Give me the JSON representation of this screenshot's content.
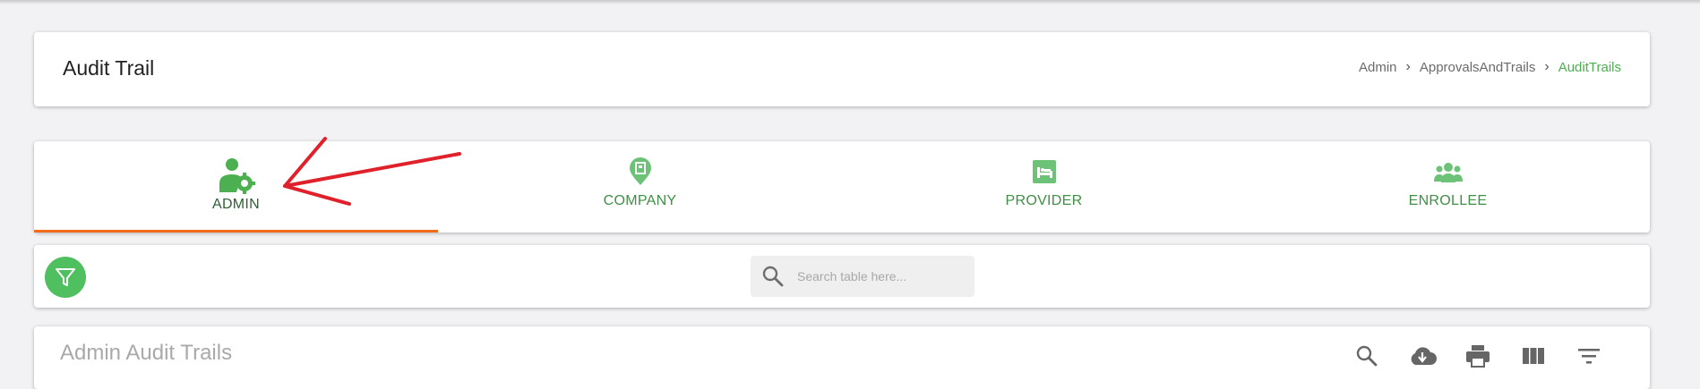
{
  "header": {
    "title": "Audit Trail",
    "breadcrumb": [
      "Admin",
      "ApprovalsAndTrails",
      "AuditTrails"
    ]
  },
  "tabs": [
    {
      "label": "ADMIN",
      "icon": "admin-settings-icon",
      "selected": true
    },
    {
      "label": "COMPANY",
      "icon": "company-location-icon",
      "selected": false
    },
    {
      "label": "PROVIDER",
      "icon": "provider-hospital-bed-icon",
      "selected": false
    },
    {
      "label": "ENROLLEE",
      "icon": "enrollee-group-icon",
      "selected": false
    }
  ],
  "filter": {
    "icon": "filter-icon",
    "search_placeholder": "Search table here..."
  },
  "table": {
    "title": "Admin Audit Trails",
    "tools": [
      "search-icon",
      "cloud-download-icon",
      "print-icon",
      "view-columns-icon",
      "filter-list-icon"
    ]
  },
  "colors": {
    "accent_green": "#4caf50",
    "tab_underline": "#f26a1b",
    "annotation_arrow": "#e0202a"
  }
}
